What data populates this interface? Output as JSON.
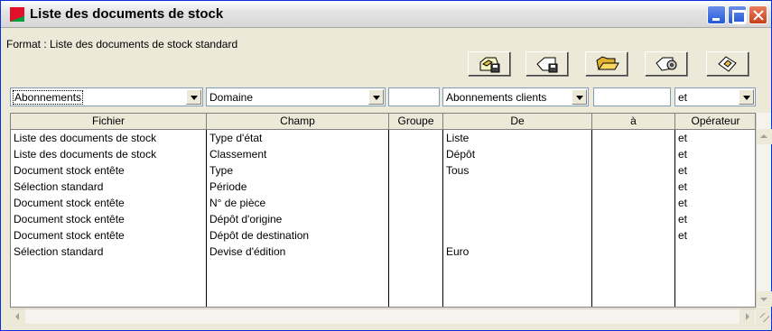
{
  "window": {
    "title": "Liste des documents de stock",
    "controls": [
      "minimize",
      "maximize",
      "close"
    ]
  },
  "format": {
    "label": "Format : Liste des documents de stock standard"
  },
  "toolbar": {
    "buttons": [
      {
        "name": "save-icon"
      },
      {
        "name": "save-as-icon"
      },
      {
        "name": "open-folder-icon"
      },
      {
        "name": "settings-icon"
      },
      {
        "name": "apply-icon"
      }
    ]
  },
  "filters": {
    "file": "Abonnements",
    "field": "Domaine",
    "group": "",
    "from": "Abonnements clients",
    "to": "",
    "operator": "et"
  },
  "grid": {
    "headers": [
      "Fichier",
      "Champ",
      "Groupe",
      "De",
      "à",
      "Opérateur"
    ],
    "rows": [
      [
        "Liste des documents de stock",
        "Type d'état",
        "",
        "Liste",
        "",
        "et"
      ],
      [
        "Liste des documents de stock",
        "Classement",
        "",
        "Dépôt",
        "",
        "et"
      ],
      [
        "Document stock entête",
        "Type",
        "",
        "Tous",
        "",
        "et"
      ],
      [
        "Sélection standard",
        "Période",
        "",
        "",
        "",
        "et"
      ],
      [
        "Document stock entête",
        "N° de pièce",
        "",
        "",
        "",
        "et"
      ],
      [
        "Document stock entête",
        "Dépôt d'origine",
        "",
        "",
        "",
        "et"
      ],
      [
        "Document stock entête",
        "Dépôt de destination",
        "",
        "",
        "",
        "et"
      ],
      [
        "Sélection standard",
        "Devise d'édition",
        "",
        "Euro",
        "",
        ""
      ]
    ]
  },
  "colors": {
    "window_bg": "#ece9d8",
    "accent_border": "#7f9db9",
    "close_button": "#c8401c"
  }
}
